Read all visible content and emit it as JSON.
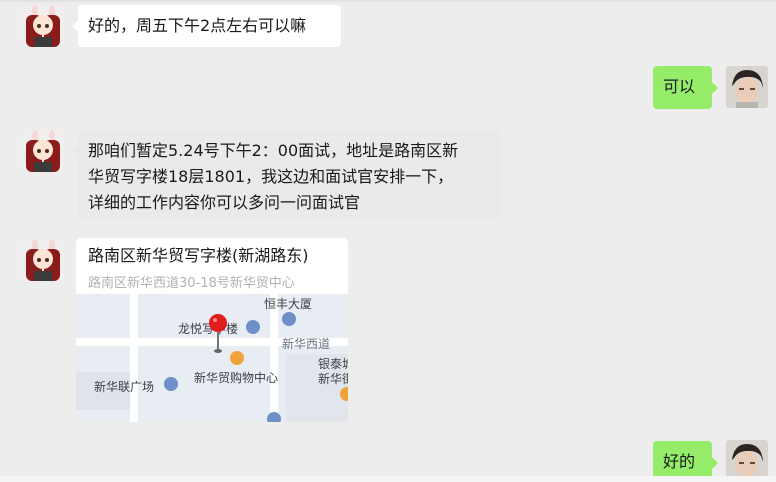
{
  "messages": {
    "m1": {
      "text": "好的，周五下午2点左右可以嘛"
    },
    "m2": {
      "text": "可以"
    },
    "m3": {
      "lines": [
        "那咱们暂定5.24号下午2：00面试，地址是路南区新",
        "华贸写字楼18层1801，我这边和面试官安排一下，",
        "详细的工作内容你可以多问一问面试官"
      ]
    },
    "location": {
      "title": "路南区新华贸写字楼(新湖路东)",
      "address": "路南区新华西道30-18号新华贸中心",
      "map_labels": {
        "hengfeng": "恒丰大厦",
        "longyue": "龙悦写字楼",
        "xinhua_road": "新华西道",
        "yintai": "银泰城",
        "xinhua_short": "新华街",
        "xinhualian": "新华联广场",
        "xinhuamao_mall": "新华贸购物中心"
      }
    },
    "m5": {
      "text": "好的"
    }
  },
  "colors": {
    "background": "#ededed",
    "incoming": "#ffffff",
    "outgoing": "#95ec69",
    "pin": "#e11d1d"
  },
  "icons": [
    "avatar-anime-girl",
    "avatar-young-man",
    "map-pin-icon",
    "building-icon",
    "shopping-icon"
  ]
}
